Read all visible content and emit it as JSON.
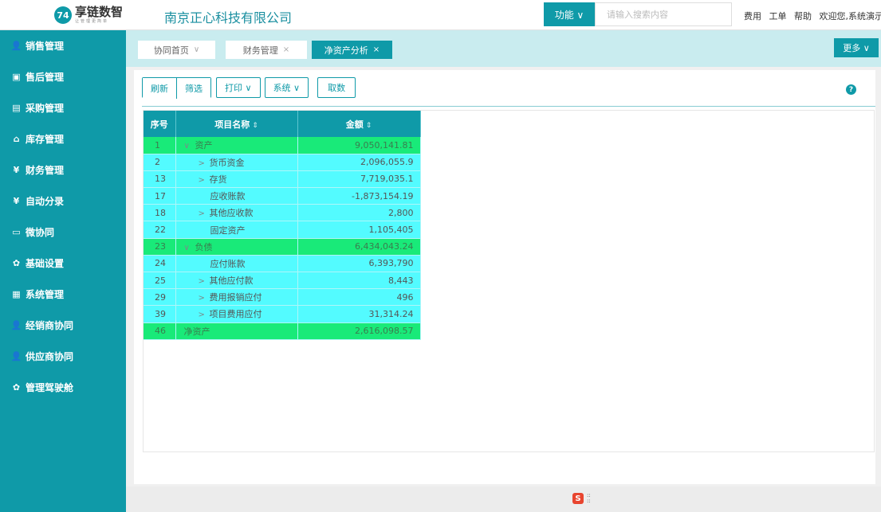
{
  "header": {
    "logo_mark": "74",
    "logo_name": "享链数智",
    "logo_sub": "让管理更简单",
    "company": "南京正心科技有限公司",
    "function_label": "功能 ∨",
    "search_placeholder": "请输入搜索内容",
    "links": [
      "费用",
      "工单",
      "帮助",
      "欢迎您,系统演示"
    ]
  },
  "sidebar": {
    "items": [
      {
        "label": "销售管理",
        "icon": "person-icon",
        "glyph": "👤"
      },
      {
        "label": "售后管理",
        "icon": "badge-icon",
        "glyph": "▣"
      },
      {
        "label": "采购管理",
        "icon": "clipboard-icon",
        "glyph": "▤"
      },
      {
        "label": "库存管理",
        "icon": "home-icon",
        "glyph": "⌂"
      },
      {
        "label": "财务管理",
        "icon": "finance-icon",
        "glyph": "¥"
      },
      {
        "label": "自动分录",
        "icon": "entry-icon",
        "glyph": "¥"
      },
      {
        "label": "微协同",
        "icon": "chat-icon",
        "glyph": "▭"
      },
      {
        "label": "基础设置",
        "icon": "gear-icon",
        "glyph": "✿"
      },
      {
        "label": "系统管理",
        "icon": "grid-icon",
        "glyph": "▦"
      },
      {
        "label": "经销商协同",
        "icon": "person-icon",
        "glyph": "👤"
      },
      {
        "label": "供应商协同",
        "icon": "person-icon",
        "glyph": "👤"
      },
      {
        "label": "管理驾驶舱",
        "icon": "gear-icon",
        "glyph": "✿"
      }
    ]
  },
  "tabs": [
    {
      "label": "协同首页",
      "suffix": "∨"
    },
    {
      "label": "财务管理",
      "suffix": "×"
    },
    {
      "label": "净资产分析",
      "suffix": "×"
    }
  ],
  "more_label": "更多 ∨",
  "toolbar": {
    "refresh": "刷新",
    "filter": "筛选",
    "print": "打印 ∨",
    "system": "系统 ∨",
    "fetch": "取数"
  },
  "help_glyph": "?",
  "table": {
    "headers": {
      "seq": "序号",
      "name": "项目名称",
      "amount": "金额",
      "sort": "⇕"
    },
    "rows": [
      {
        "seq": "1",
        "chevron": "∨",
        "name": "资产",
        "amount": "9,050,141.81",
        "style": "green"
      },
      {
        "seq": "2",
        "chevron": ">",
        "name": "货币资金",
        "amount": "2,096,055.9",
        "style": "cyan"
      },
      {
        "seq": "13",
        "chevron": ">",
        "name": "存货",
        "amount": "7,719,035.1",
        "style": "cyan"
      },
      {
        "seq": "17",
        "chevron": "",
        "name": "应收账款",
        "amount": "-1,873,154.19",
        "style": "cyan"
      },
      {
        "seq": "18",
        "chevron": ">",
        "name": "其他应收款",
        "amount": "2,800",
        "style": "cyan"
      },
      {
        "seq": "22",
        "chevron": "",
        "name": "固定资产",
        "amount": "1,105,405",
        "style": "cyan"
      },
      {
        "seq": "23",
        "chevron": "∨",
        "name": "负债",
        "amount": "6,434,043.24",
        "style": "green"
      },
      {
        "seq": "24",
        "chevron": "",
        "name": "应付账款",
        "amount": "6,393,790",
        "style": "cyan"
      },
      {
        "seq": "25",
        "chevron": ">",
        "name": "其他应付款",
        "amount": "8,443",
        "style": "cyan"
      },
      {
        "seq": "29",
        "chevron": ">",
        "name": "费用报销应付",
        "amount": "496",
        "style": "cyan"
      },
      {
        "seq": "39",
        "chevron": ">",
        "name": "项目费用应付",
        "amount": "31,314.24",
        "style": "cyan"
      },
      {
        "seq": "46",
        "chevron": "",
        "name": "净资产",
        "amount": "2,616,098.57",
        "style": "green"
      }
    ]
  },
  "footer": {
    "logo_glyph": "S"
  }
}
